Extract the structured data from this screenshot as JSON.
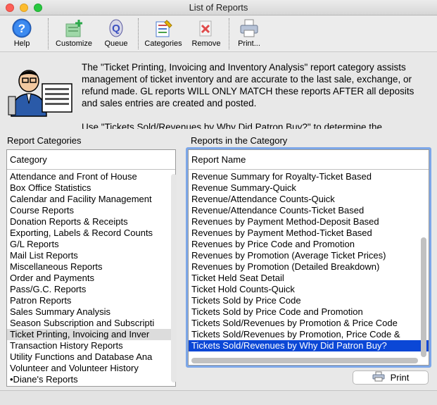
{
  "window": {
    "title": "List of Reports"
  },
  "toolbar": {
    "help": "Help",
    "customize": "Customize",
    "queue": "Queue",
    "categories": "Categories",
    "remove": "Remove",
    "print": "Print..."
  },
  "info": {
    "paragraph1": "The \"Ticket Printing, Invoicing and Inventory Analysis\" report category assists management of ticket inventory and are accurate to the last sale, exchange, or refund made. GL reports WILL ONLY MATCH these reports AFTER all deposits and sales entries are created and posted.",
    "paragraph2": "Use \"Tickets Sold/Revenues by Why Did Patron Buy?\" to determine the"
  },
  "categories": {
    "label": "Report Categories",
    "header": "Category",
    "items": [
      "Attendance and Front of House",
      "Box Office Statistics",
      "Calendar and Facility Management",
      "Course Reports",
      "Donation Reports & Receipts",
      "Exporting, Labels & Record Counts",
      "G/L Reports",
      "Mail List Reports",
      "Miscellaneous Reports",
      "Order and Payments",
      "Pass/G.C. Reports",
      "Patron Reports",
      "Sales Summary Analysis",
      "Season Subscription and Subscripti",
      "Ticket Printing, Invoicing and Inver",
      "Transaction History Reports",
      "Utility Functions and Database Ana",
      "Volunteer and Volunteer History",
      "•Diane's Reports"
    ]
  },
  "reports": {
    "label": "Reports in the Category",
    "header": "Report Name",
    "items": [
      "Revenue Summary for Royalty-Ticket Based",
      "Revenue Summary-Quick",
      "Revenue/Attendance Counts-Quick",
      "Revenue/Attendance Counts-Ticket Based",
      "Revenues by Payment Method-Deposit Based",
      "Revenues by Payment Method-Ticket Based",
      "Revenues by Price Code and Promotion",
      "Revenues by Promotion (Average Ticket Prices)",
      "Revenues by Promotion (Detailed Breakdown)",
      "Ticket Held Seat Detail",
      "Ticket Hold Counts-Quick",
      "Tickets Sold by Price Code",
      "Tickets Sold by Price Code and Promotion",
      "Tickets Sold/Revenues by Promotion & Price Code",
      "Tickets Sold/Revenues by Promotion, Price Code &",
      "Tickets Sold/Revenues by Why Did Patron Buy?"
    ]
  },
  "print_button": "Print",
  "colors": {
    "selection": "#0b47d6",
    "focus": "#7da7e8"
  }
}
